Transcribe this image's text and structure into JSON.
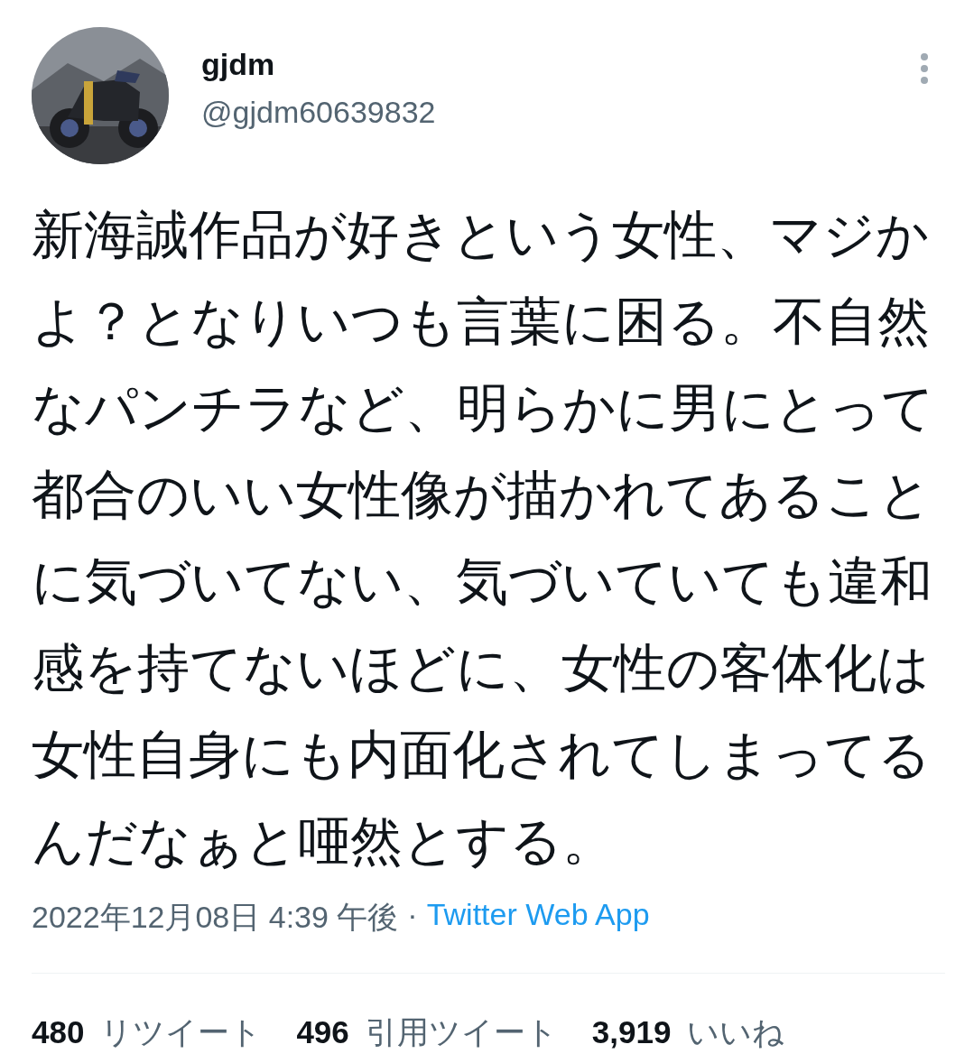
{
  "author": {
    "name": "gjdm",
    "handle": "@gjdm60639832"
  },
  "tweet": {
    "text": "新海誠作品が好きという女性、マジかよ？となりいつも言葉に困る。不自然なパンチラなど、明らかに男にとって都合のいい女性像が描かれてあることに気づいてない、気づいていても違和感を持てないほどに、女性の客体化は女性自身にも内面化されてしまってるんだなぁと唖然とする。"
  },
  "meta": {
    "timestamp": "2022年12月08日 4:39 午後",
    "separator": "·",
    "source": "Twitter Web App"
  },
  "stats": [
    {
      "count": "480",
      "label": "リツイート"
    },
    {
      "count": "496",
      "label": "引用ツイート"
    },
    {
      "count": "3,919",
      "label": "いいね"
    }
  ]
}
